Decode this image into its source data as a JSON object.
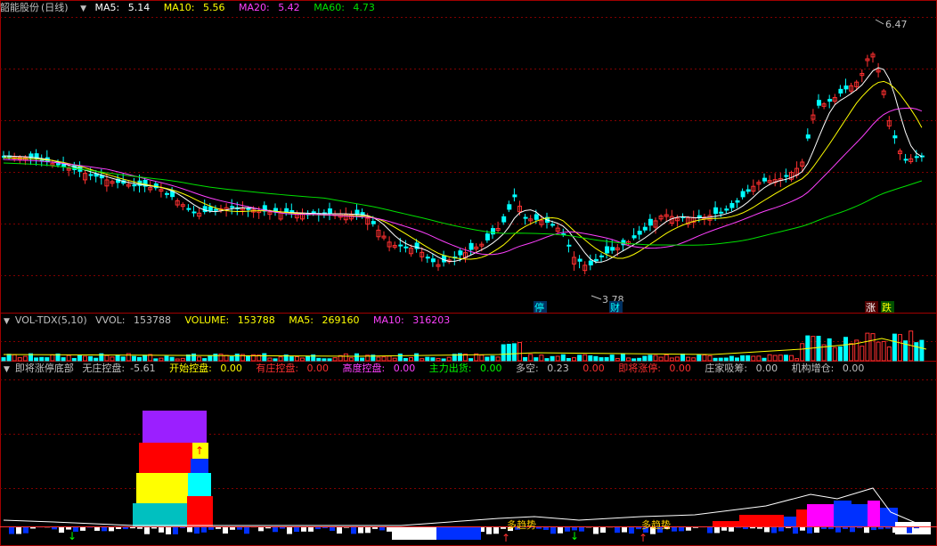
{
  "main_panel": {
    "stock_name": "韶能股份",
    "period": "(日线)",
    "ma": [
      {
        "label": "MA5:",
        "value": "5.14",
        "color": "#ffffff"
      },
      {
        "label": "MA10:",
        "value": "5.56",
        "color": "#ffff00"
      },
      {
        "label": "MA20:",
        "value": "5.42",
        "color": "#ff40ff"
      },
      {
        "label": "MA60:",
        "value": "4.73",
        "color": "#00e000"
      }
    ],
    "high_label": "6.47",
    "low_label": "3.78",
    "markers": [
      "停",
      "财",
      "涨",
      "跌"
    ]
  },
  "volume_panel": {
    "name": "VOL-TDX(5,10)",
    "items": [
      {
        "label": "VVOL:",
        "value": "153788",
        "color": "#c0c0c0"
      },
      {
        "label": "VOLUME:",
        "value": "153788",
        "color": "#ffff00"
      },
      {
        "label": "MA5:",
        "value": "269160",
        "color": "#ffff00"
      },
      {
        "label": "MA10:",
        "value": "316203",
        "color": "#ff40ff"
      }
    ]
  },
  "indicator_panel": {
    "name": "即将涨停底部",
    "items": [
      {
        "label": "无庄控盘:",
        "value": "-5.61",
        "color": "#c0c0c0"
      },
      {
        "label": "开始控盘:",
        "value": "0.00",
        "color": "#ffff00"
      },
      {
        "label": "有庄控盘:",
        "value": "0.00",
        "color": "#ff3030"
      },
      {
        "label": "高度控盘:",
        "value": "0.00",
        "color": "#ff40ff"
      },
      {
        "label": "主力出货:",
        "value": "0.00",
        "color": "#00ff00"
      },
      {
        "label": "多空:",
        "value": "0.23",
        "color": "#c0c0c0"
      },
      {
        "label": "",
        "value": "0.00",
        "color": "#ff3030"
      },
      {
        "label": "即将涨停:",
        "value": "0.00",
        "color": "#ff3030"
      },
      {
        "label": "庄家吸筹:",
        "value": "0.00",
        "color": "#c0c0c0"
      },
      {
        "label": "机构增仓:",
        "value": "0.00",
        "color": "#c0c0c0"
      }
    ],
    "signal_labels": [
      "多趋势",
      "多趋势"
    ]
  },
  "colors": {
    "up": "#ff3030",
    "down": "#00ffff",
    "grid": "#800000"
  }
}
